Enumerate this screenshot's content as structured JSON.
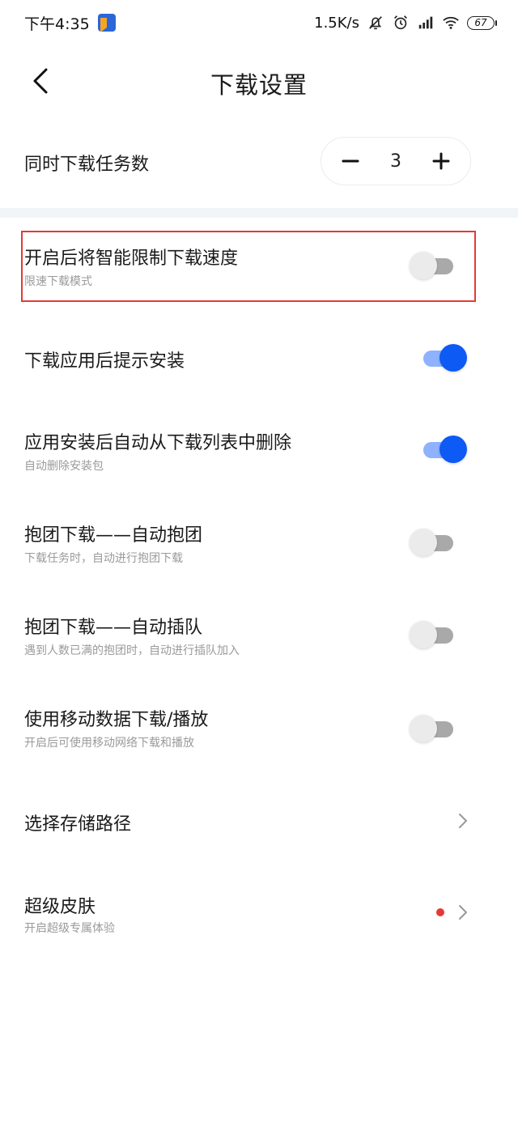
{
  "status_bar": {
    "time": "下午4:35",
    "net_speed": "1.5K/s",
    "battery": "67"
  },
  "header": {
    "title": "下载设置"
  },
  "concurrent": {
    "label": "同时下载任务数",
    "value": "3",
    "minus": "−",
    "plus": "+"
  },
  "settings": [
    {
      "title": "开启后将智能限制下载速度",
      "subtitle": "限速下载模式",
      "toggle": "off"
    },
    {
      "title": "下载应用后提示安装",
      "subtitle": "",
      "toggle": "on"
    },
    {
      "title": "应用安装后自动从下载列表中删除",
      "subtitle": "自动删除安装包",
      "toggle": "on"
    },
    {
      "title": "抱团下载——自动抱团",
      "subtitle": "下载任务时，自动进行抱团下载",
      "toggle": "off"
    },
    {
      "title": "抱团下载——自动插队",
      "subtitle": "遇到人数已满的抱团时，自动进行插队加入",
      "toggle": "off"
    },
    {
      "title": "使用移动数据下载/播放",
      "subtitle": "开启后可使用移动网络下载和播放",
      "toggle": "off"
    }
  ],
  "nav_rows": [
    {
      "title": "选择存储路径",
      "subtitle": ""
    },
    {
      "title": "超级皮肤",
      "subtitle": "开启超级专属体验"
    }
  ],
  "colors": {
    "accent": "#0d5af5",
    "highlight": "#e53935",
    "badge": "#e53935"
  }
}
